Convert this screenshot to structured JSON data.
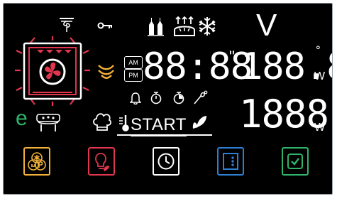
{
  "panel": {
    "colors": {
      "background": "#000000",
      "foreground": "#ffffff",
      "accent_red": "#e0364e",
      "accent_amber": "#f2b13a",
      "accent_green": "#2fb46a",
      "accent_blue": "#2d7fd3"
    }
  },
  "display": {
    "voltage_unit": "V",
    "clock": {
      "am": "AM",
      "pm": "PM",
      "time": "88:88",
      "seconds_mark": "\""
    },
    "upper_power": {
      "value": "188.8",
      "degree": "°",
      "unit": "W"
    },
    "lower_power": {
      "value": "1888",
      "unit": "W"
    },
    "start_label": "START",
    "eco_letter": "e"
  },
  "icons": [
    "fan-bake-icon",
    "key-lock-icon",
    "bottles-icon",
    "bread-rise-icon",
    "snowflake-icon",
    "oven-cavity-icon",
    "steam-icon",
    "bell-icon",
    "timer-icon",
    "end-timer-icon",
    "meat-probe-icon",
    "pizza-icon",
    "chef-hat-icon",
    "thermometer-icon",
    "leaf-icon"
  ],
  "buttons": [
    {
      "name": "recipes-button",
      "color": "#f2b13a",
      "icon": "recipes-icon"
    },
    {
      "name": "light-button",
      "color": "#e0364e",
      "icon": "light-bulb-icon"
    },
    {
      "name": "timer-button",
      "color": "#ffffff",
      "icon": "clock-icon"
    },
    {
      "name": "door-button",
      "color": "#2d7fd3",
      "icon": "door-icon"
    },
    {
      "name": "confirm-button",
      "color": "#2fb46a",
      "icon": "check-icon"
    }
  ]
}
